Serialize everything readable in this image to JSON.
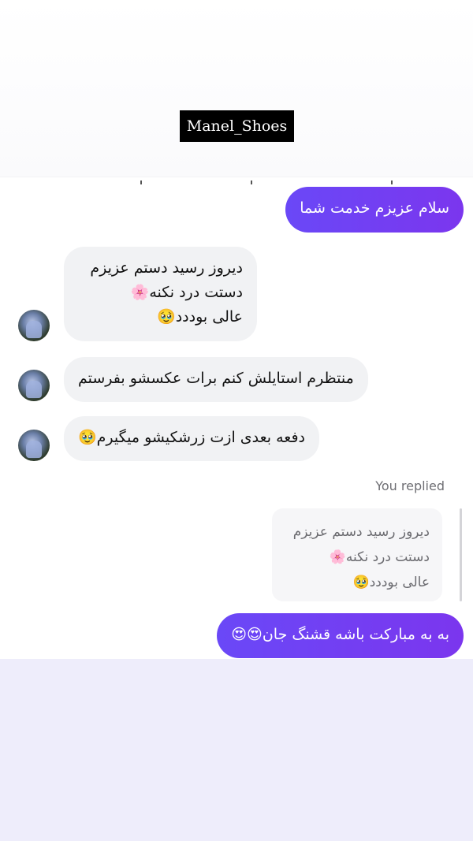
{
  "brand": {
    "label": "Manel_Shoes"
  },
  "messages": [
    {
      "from": "me",
      "text": "سلام عزیزم خدمت شما"
    },
    {
      "from": "them",
      "text": "دیروز رسید دستم عزیزم\nدستت درد نکنه🌸\nعالی بوددد🥹"
    },
    {
      "from": "them",
      "text": "منتظرم استایلش کنم برات عکسشو بفرستم"
    },
    {
      "from": "them",
      "text": "دفعه بعدی ازت زرشکیشو میگیرم🥹"
    },
    {
      "from": "me",
      "text": "به به مبارکت باشه قشنگ جان😍😍"
    }
  ],
  "reply": {
    "label": "You replied",
    "quoted_text": "دیروز رسید دستم عزیزم\nدستت درد نکنه🌸\nعالی بوددد🥹"
  },
  "colors": {
    "outgoing_bubble": "#6a48f7",
    "incoming_bubble": "#f1f2f4",
    "bottom_panel": "#eeedfb"
  },
  "icons": {
    "avatar": "profile-avatar"
  }
}
